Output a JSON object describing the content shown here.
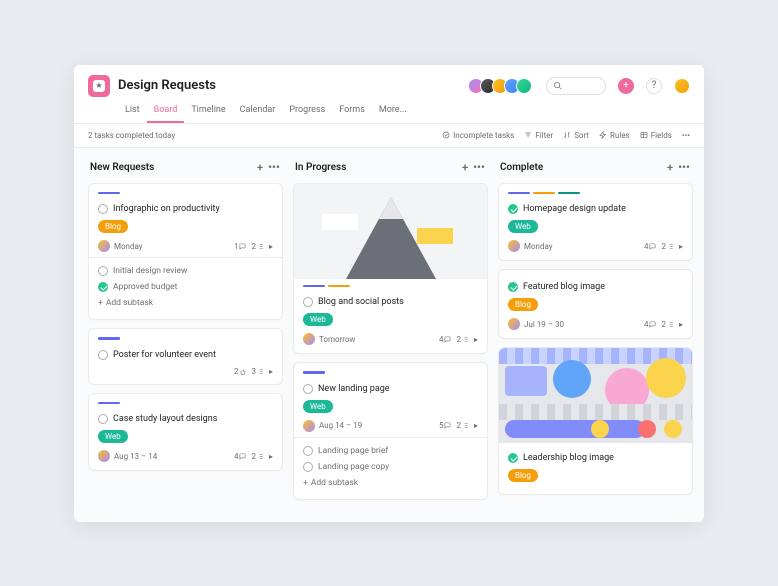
{
  "header": {
    "title": "Design Requests"
  },
  "nav": [
    "List",
    "Board",
    "Timeline",
    "Calendar",
    "Progress",
    "Forms",
    "More..."
  ],
  "nav_active": 1,
  "status": "2 tasks completed today",
  "tools": {
    "incomplete": "Incomplete tasks",
    "filter": "Filter",
    "sort": "Sort",
    "rules": "Rules",
    "fields": "Fields"
  },
  "columns": [
    {
      "name": "New Requests",
      "cards": [
        {
          "stripes": [
            "purple"
          ],
          "title": "Infographic on productivity",
          "tag": {
            "label": "Blog",
            "style": "orange"
          },
          "date": "Monday",
          "avatar": true,
          "comments": 1,
          "subtasks": 2,
          "subs": [
            {
              "done": true,
              "title": "Initial design review"
            },
            {
              "done": true,
              "title": "Approved budget",
              "mark": true
            }
          ],
          "add": "Add subtask"
        },
        {
          "stripes": [
            "purple"
          ],
          "title": "Poster for volunteer event",
          "likes": 2,
          "subtasks": 3
        },
        {
          "stripes": [
            "purple"
          ],
          "title": "Case study layout designs",
          "tag": {
            "label": "Web",
            "style": "teal"
          },
          "date": "Aug 13 – 14",
          "avatar": true,
          "comments": 4,
          "subtasks": 2
        }
      ]
    },
    {
      "name": "In Progress",
      "cards": [
        {
          "hero": "mountain",
          "stripes": [
            "purple",
            "orange"
          ],
          "title": "Blog and social posts",
          "tag": {
            "label": "Web",
            "style": "teal"
          },
          "date": "Tomorrow",
          "avatar": true,
          "comments": 4,
          "subtasks": 2
        },
        {
          "stripes": [
            "purple"
          ],
          "title": "New landing page",
          "tag": {
            "label": "Web",
            "style": "teal"
          },
          "date": "Aug 14 – 19",
          "avatar": true,
          "comments": 5,
          "subtasks": 2,
          "subs": [
            {
              "title": "Landing page brief"
            },
            {
              "title": "Landing page copy"
            }
          ],
          "add": "Add subtask"
        }
      ]
    },
    {
      "name": "Complete",
      "cards": [
        {
          "stripes": [
            "purple",
            "orange",
            "teal"
          ],
          "title": "Homepage design update",
          "done": true,
          "tag": {
            "label": "Web",
            "style": "teal"
          },
          "date": "Monday",
          "avatar": true,
          "comments": 4,
          "subtasks": 2
        },
        {
          "stripes": [],
          "title": "Featured blog image",
          "done": true,
          "tag": {
            "label": "Blog",
            "style": "orange"
          },
          "date": "Jul 19 – 30",
          "avatar": true,
          "comments": 4,
          "subtasks": 2
        },
        {
          "hero": "collage",
          "title": "Leadership blog image",
          "done": true,
          "tag": {
            "label": "Blog",
            "style": "orange"
          }
        }
      ]
    }
  ]
}
